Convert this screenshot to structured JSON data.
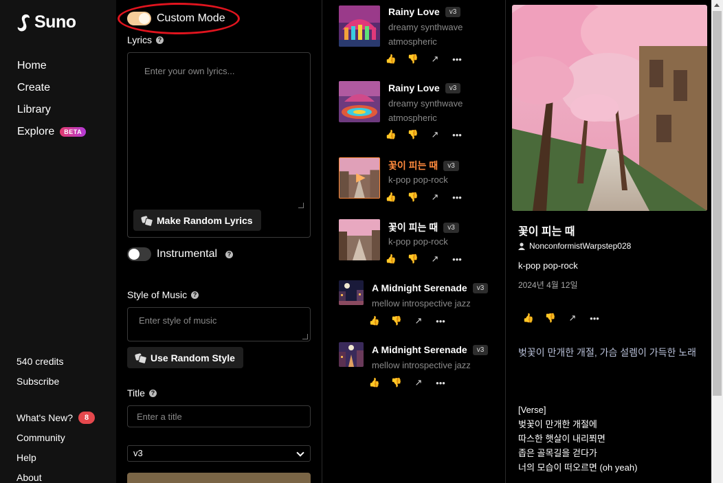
{
  "brand": {
    "name": "Suno"
  },
  "nav": [
    {
      "label": "Home"
    },
    {
      "label": "Create"
    },
    {
      "label": "Library"
    },
    {
      "label": "Explore",
      "badge": "BETA"
    }
  ],
  "account": {
    "credits": "540 credits",
    "subscribe": "Subscribe",
    "whats_new": "What's New?",
    "whats_new_count": "8",
    "community": "Community",
    "help": "Help",
    "about": "About"
  },
  "form": {
    "custom_mode_label": "Custom Mode",
    "custom_mode_on": true,
    "lyrics_label": "Lyrics",
    "lyrics_placeholder": "Enter your own lyrics...",
    "random_lyrics_btn": "Make Random Lyrics",
    "instrumental_label": "Instrumental",
    "instrumental_on": false,
    "style_label": "Style of Music",
    "style_placeholder": "Enter style of music",
    "random_style_btn": "Use Random Style",
    "title_label": "Title",
    "title_placeholder": "Enter a title",
    "version_value": "v3"
  },
  "songs": [
    {
      "title": "Rainy Love",
      "version": "v3",
      "tags_line1": "dreamy synthwave",
      "tags_line2": "atmospheric"
    },
    {
      "title": "Rainy Love",
      "version": "v3",
      "tags_line1": "dreamy synthwave",
      "tags_line2": "atmospheric"
    },
    {
      "title": "꽃이 피는 때",
      "version": "v3",
      "tags_line1": "k-pop pop-rock",
      "playing": true
    },
    {
      "title": "꽃이 피는 때",
      "version": "v3",
      "tags_line1": "k-pop pop-rock"
    },
    {
      "title": "A Midnight Serenade",
      "version": "v3",
      "tags_line1": "mellow introspective jazz"
    },
    {
      "title": "A Midnight Serenade",
      "version": "v3",
      "tags_line1": "mellow introspective jazz"
    }
  ],
  "detail": {
    "title": "꽃이 피는 때",
    "user": "NonconformistWarpstep028",
    "style": "k-pop pop-rock",
    "date": "2024년 4월 12일",
    "description": "벚꽃이 만개한 개절, 가슴 설렘이 가득한 노래",
    "lyrics": "[Verse]\n벚꽃이 만개한 개절에\n따스한 햇살이 내리쬐면\n좁은 골목길을 걷다가\n너의 모습이 떠오르면 (oh yeah)"
  },
  "colors": {
    "accent_playing": "#ff8a3d",
    "toggle_on": "#f5cd9a",
    "highlight_ring": "#e0141e",
    "beta_badge": "#c43bb5",
    "notification_badge": "#e5484d"
  },
  "icons": [
    "thumbs-up-icon",
    "thumbs-down-icon",
    "share-icon",
    "more-icon",
    "user-icon",
    "dice-icon",
    "help-icon",
    "play-icon"
  ]
}
